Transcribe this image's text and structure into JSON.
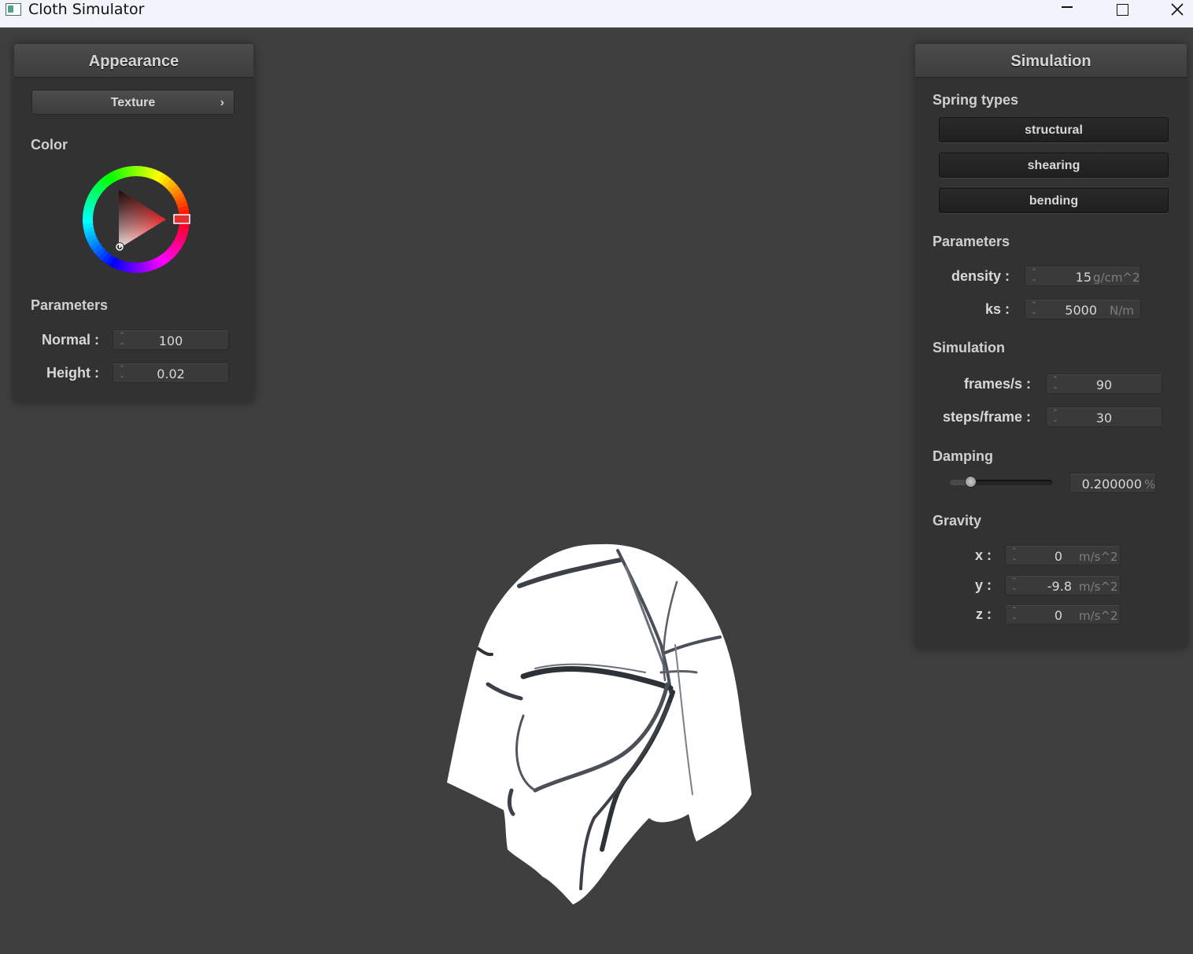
{
  "window": {
    "title": "Cloth Simulator",
    "controls": {
      "minimize": "minimize",
      "maximize": "maximize",
      "close": "close"
    }
  },
  "appearance": {
    "header": "Appearance",
    "texture_button": "Texture",
    "color_label": "Color",
    "color": "#e03030",
    "parameters_label": "Parameters",
    "normal_label": "Normal :",
    "normal_value": "100",
    "height_label": "Height :",
    "height_value": "0.02"
  },
  "simulation": {
    "header": "Simulation",
    "spring_types_label": "Spring types",
    "spring_types": [
      "structural",
      "shearing",
      "bending"
    ],
    "parameters_label": "Parameters",
    "density_label": "density :",
    "density_value": "15",
    "density_unit": "g/cm^2",
    "ks_label": "ks :",
    "ks_value": "5000",
    "ks_unit": "N/m",
    "simulation_label": "Simulation",
    "fps_label": "frames/s :",
    "fps_value": "90",
    "steps_label": "steps/frame :",
    "steps_value": "30",
    "damping_label": "Damping",
    "damping_level": 0.2,
    "damping_value": "0.200000",
    "damping_unit": "%",
    "gravity_label": "Gravity",
    "gravity": [
      {
        "label": "x :",
        "value": "0",
        "unit": "m/s^2"
      },
      {
        "label": "y :",
        "value": "-9.8",
        "unit": "m/s^2"
      },
      {
        "label": "z :",
        "value": "0",
        "unit": "m/s^2"
      }
    ]
  }
}
